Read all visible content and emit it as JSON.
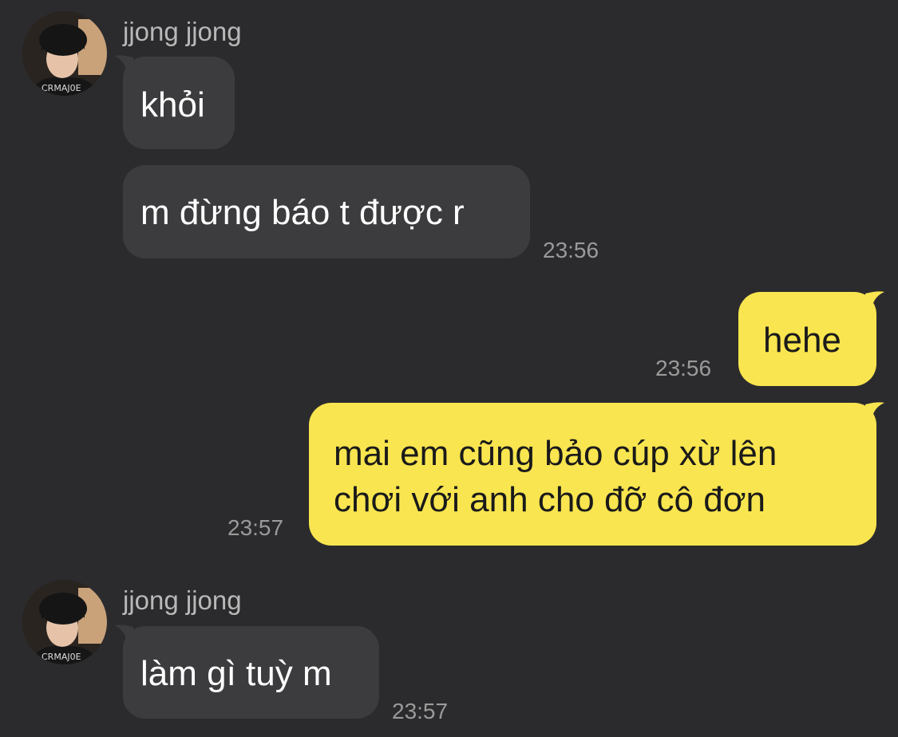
{
  "colors": {
    "background": "#2b2b2d",
    "incoming_bubble": "#3c3c3e",
    "outgoing_bubble": "#f9e54f",
    "timestamp": "#9a9a9a",
    "sender_name": "#b8b8b8"
  },
  "messages": {
    "group1": {
      "sender": "jjong jjong",
      "avatar_icon": "profile-photo-icon",
      "msg1": "khỏi",
      "msg2": "m đừng báo t được r",
      "time": "23:56"
    },
    "out1": {
      "text": "hehe",
      "time": "23:56"
    },
    "out2": {
      "line1": "mai em cũng bảo cúp xừ lên",
      "line2": "chơi với anh cho đỡ cô đơn",
      "time": "23:57"
    },
    "group2": {
      "sender": "jjong jjong",
      "avatar_icon": "profile-photo-icon",
      "msg1": "làm gì tuỳ m",
      "time": "23:57"
    }
  }
}
